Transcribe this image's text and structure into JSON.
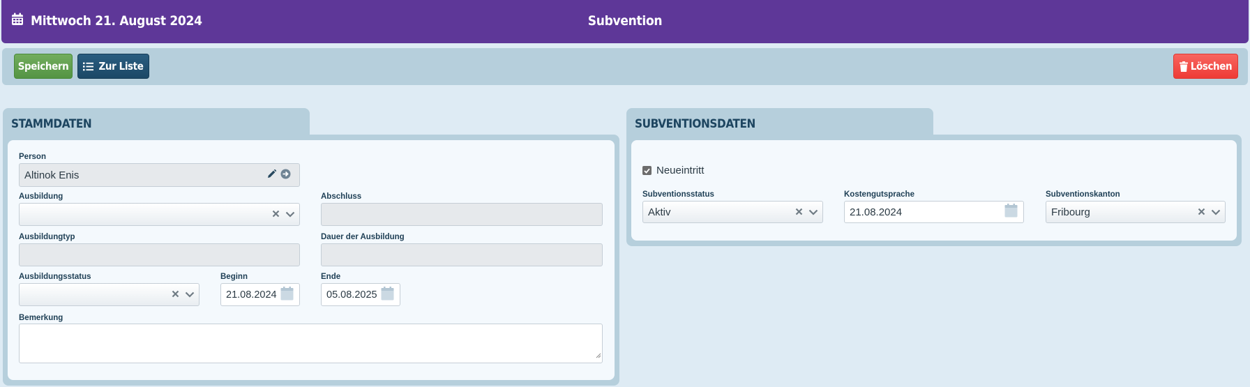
{
  "header": {
    "date": "Mittwoch 21. August 2024",
    "title": "Subvention"
  },
  "toolbar": {
    "save_label": "Speichern",
    "list_label": "Zur Liste",
    "delete_label": "Löschen"
  },
  "stammdaten": {
    "tab_label": "STAMMDATEN",
    "person_label": "Person",
    "person_value": "Altinok Enis",
    "ausbildung_label": "Ausbildung",
    "ausbildung_value": "",
    "abschluss_label": "Abschluss",
    "abschluss_value": "",
    "ausbildungtyp_label": "Ausbildungtyp",
    "ausbildungtyp_value": "",
    "dauer_label": "Dauer der Ausbildung",
    "dauer_value": "",
    "ausbildungsstatus_label": "Ausbildungsstatus",
    "ausbildungsstatus_value": "",
    "beginn_label": "Beginn",
    "beginn_value": "21.08.2024",
    "ende_label": "Ende",
    "ende_value": "05.08.2025",
    "bemerkung_label": "Bemerkung",
    "bemerkung_value": ""
  },
  "subventionsdaten": {
    "tab_label": "SUBVENTIONSDATEN",
    "neueintritt_label": "Neueintritt",
    "neueintritt_checked": true,
    "status_label": "Subventionsstatus",
    "status_value": "Aktiv",
    "kostengutsprache_label": "Kostengutsprache",
    "kostengutsprache_value": "21.08.2024",
    "kanton_label": "Subventionskanton",
    "kanton_value": "Fribourg"
  },
  "colors": {
    "header_bg": "#5e3798",
    "save_green": "#5c9b4a",
    "list_blue": "#1f4e6f",
    "delete_red": "#f1453f",
    "panel_bg": "#b6cfdc",
    "page_bg": "#deebf4"
  },
  "icons": {
    "header": "calendar-icon",
    "list": "list-icon",
    "delete": "trash-icon",
    "edit": "pencil-icon",
    "goto": "arrow-right-circle-icon",
    "clear": "clear-x-icon",
    "dropdown": "chevron-down-icon",
    "date": "calendar-icon",
    "check": "checkmark-icon"
  }
}
